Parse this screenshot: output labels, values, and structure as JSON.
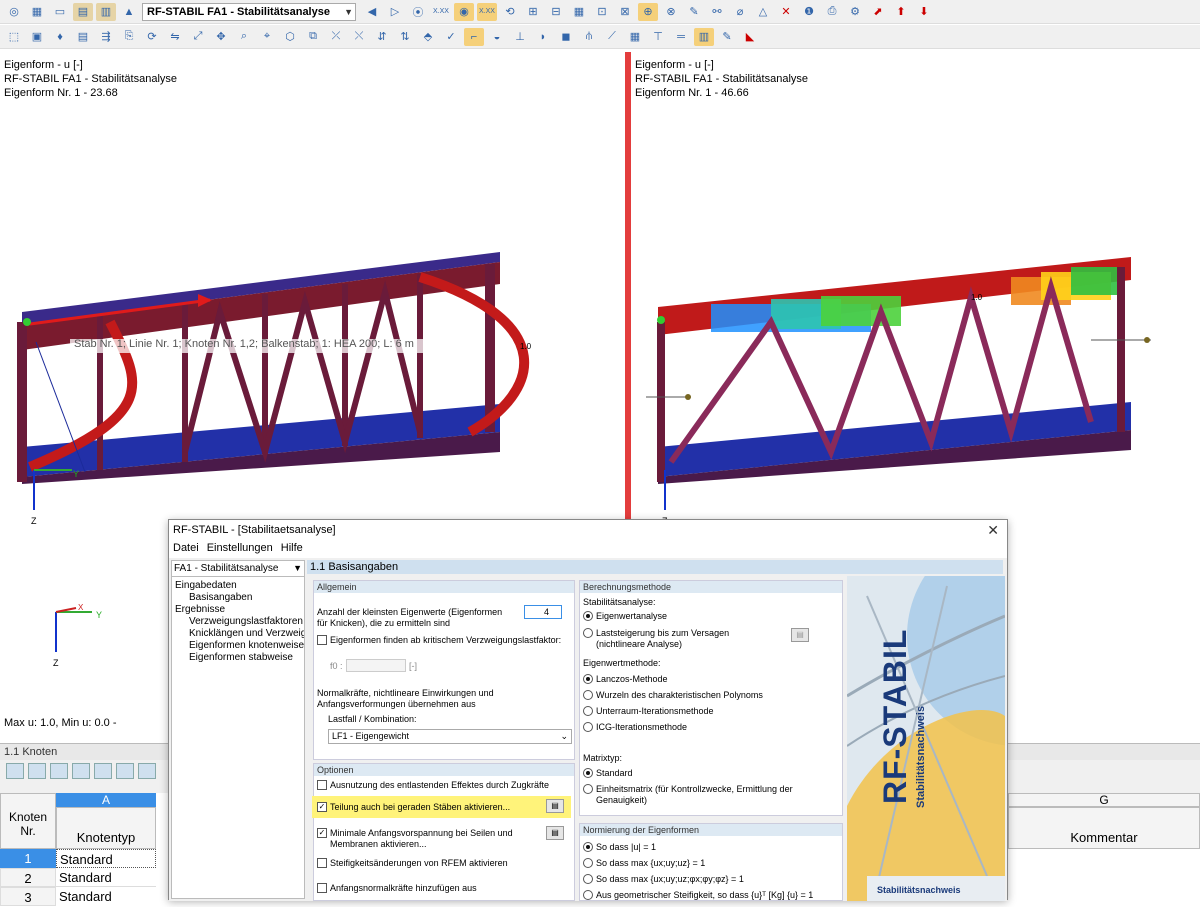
{
  "toolbar": {
    "combo_value": "RF-STABIL FA1 - Stabilitätsanalyse",
    "badge1": "X.XX",
    "badge2": "X.XX"
  },
  "left_view": {
    "line1": "Eigenform - u [-]",
    "line2": "RF-STABIL FA1 - Stabilitätsanalyse",
    "line3": "Eigenform Nr. 1  -  23.68",
    "tooltip": "Stab Nr. 1; Linie Nr. 1; Knoten Nr. 1,2; Balkenstab; 1: HEA 200; L: 6 m",
    "mark": "1.0",
    "axis_y": "Y",
    "axis_z": "Z",
    "axis2_x": "X",
    "axis2_y": "Y",
    "axis2_z": "Z",
    "footer": "Max u: 1.0, Min u: 0.0 -"
  },
  "right_view": {
    "line1": "Eigenform - u [-]",
    "line2": "RF-STABIL FA1 - Stabilitätsanalyse",
    "line3": "Eigenform Nr. 1  -  46.66",
    "mark": "1.0",
    "axis_z": "Z"
  },
  "table": {
    "title": "1.1 Knoten",
    "col_a": "A",
    "col_g": "G",
    "hdr_knoten": "Knoten",
    "hdr_nr": "Nr.",
    "hdr_typ": "Knotentyp",
    "hdr_kommentar": "Kommentar",
    "rows": [
      {
        "nr": "1",
        "typ": "Standard"
      },
      {
        "nr": "2",
        "typ": "Standard"
      },
      {
        "nr": "3",
        "typ": "Standard"
      }
    ]
  },
  "dialog": {
    "title": "RF-STABIL - [Stabilitaetsanalyse]",
    "close": "✕",
    "menu": [
      "Datei",
      "Einstellungen",
      "Hilfe"
    ],
    "case_select": "FA1 - Stabilitätsanalyse",
    "nav": {
      "eingabedaten": "Eingabedaten",
      "basisangaben": "Basisangaben",
      "ergebnisse": "Ergebnisse",
      "r1": "Verzweigungslastfaktoren",
      "r2": "Knicklängen und Verzweigungsl",
      "r3": "Eigenformen knotenweise",
      "r4": "Eigenformen stabweise"
    },
    "section": "1.1 Basisangaben",
    "allgemein": {
      "title": "Allgemein",
      "anzahl_label": "Anzahl der kleinsten Eigenwerte (Eigenformen für Knicken), die zu ermitteln sind",
      "anzahl_value": "4",
      "finden_label": "Eigenformen finden ab kritischem Verzweigungslastfaktor:",
      "f0_label": "f0 :",
      "f0_unit": "[-]",
      "normal_label": "Normalkräfte, nichtlineare Einwirkungen und Anfangsverformungen übernehmen aus",
      "lastfall_label": "Lastfall / Kombination:",
      "lastfall_value": "LF1 - Eigengewicht"
    },
    "optionen": {
      "title": "Optionen",
      "o1": "Ausnutzung des entlastenden Effektes durch Zugkräfte",
      "o2": "Teilung auch bei geraden Stäben aktivieren...",
      "o3": "Minimale Anfangsvorspannung bei Seilen und Membranen aktivieren...",
      "o4": "Steifigkeitsänderungen von RFEM aktivieren",
      "o5": "Anfangsnormalkräfte hinzufügen aus"
    },
    "berechnung": {
      "title": "Berechnungsmethode",
      "stab_label": "Stabilitätsanalyse:",
      "s1": "Eigenwertanalyse",
      "s2": "Laststeigerung bis zum Versagen (nichtlineare Analyse)",
      "eig_label": "Eigenwertmethode:",
      "e1": "Lanczos-Methode",
      "e2": "Wurzeln des charakteristischen Polynoms",
      "e3": "Unterraum-Iterationsmethode",
      "e4": "ICG-Iterationsmethode",
      "mat_label": "Matrixtyp:",
      "m1": "Standard",
      "m2": "Einheitsmatrix (für Kontrollzwecke, Ermittlung der Genauigkeit)"
    },
    "normierung": {
      "title": "Normierung der Eigenformen",
      "n1": "So dass |u| = 1",
      "n2": "So dass max {ux;uy;uz} = 1",
      "n3": "So dass max {ux;uy;uz;φx;φy;φz} = 1",
      "n4": "Aus geometrischer Steifigkeit, so dass {u}ᵀ [Kg] {u} = 1"
    },
    "logo": {
      "main": "RF-STABIL",
      "sub": "Stabilitätsnachweis",
      "footer": "Stabilitätsnachweis"
    }
  }
}
